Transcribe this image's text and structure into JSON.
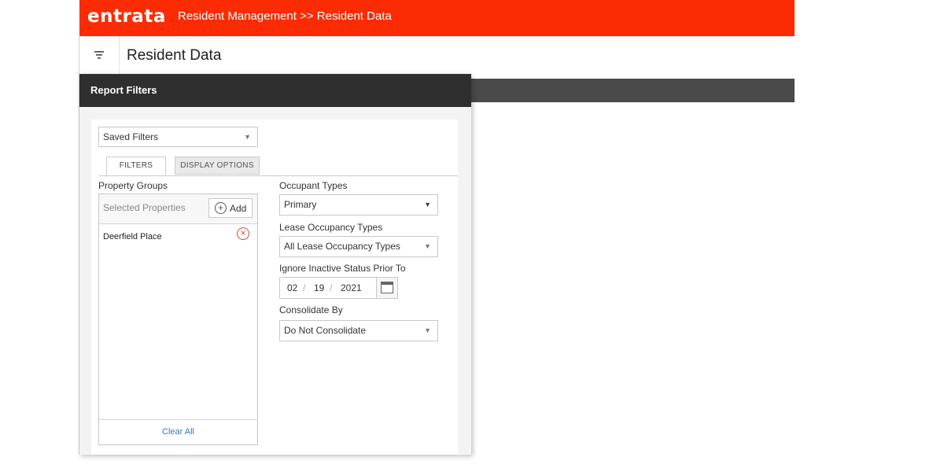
{
  "header": {
    "brand": "entrata",
    "breadcrumb": "Resident Management >> Resident Data"
  },
  "page": {
    "title": "Resident Data"
  },
  "filters_panel": {
    "title": "Report Filters",
    "saved_filters": "Saved Filters",
    "tabs": [
      {
        "label": "FILTERS",
        "active": true
      },
      {
        "label": "DISPLAY OPTIONS",
        "active": false
      }
    ],
    "property_groups": {
      "label": "Property Groups",
      "placeholder": "Selected Properties",
      "add_label": "Add",
      "items": [
        "Deerfield Place"
      ],
      "clear_label": "Clear All"
    },
    "occupant_types": {
      "label": "Occupant Types",
      "value": "Primary"
    },
    "lease_occupancy_types": {
      "label": "Lease Occupancy Types",
      "value": "All Lease Occupancy Types"
    },
    "ignore_inactive": {
      "label": "Ignore Inactive Status Prior To",
      "month": "02",
      "day": "19",
      "year": "2021",
      "separator": "/"
    },
    "consolidate_by": {
      "label": "Consolidate By",
      "value": "Do Not Consolidate"
    }
  },
  "colors": {
    "brand": "#fb2c03",
    "panel_header": "#2f2f2f",
    "link": "#2a7bc4",
    "remove": "#e0453a"
  }
}
